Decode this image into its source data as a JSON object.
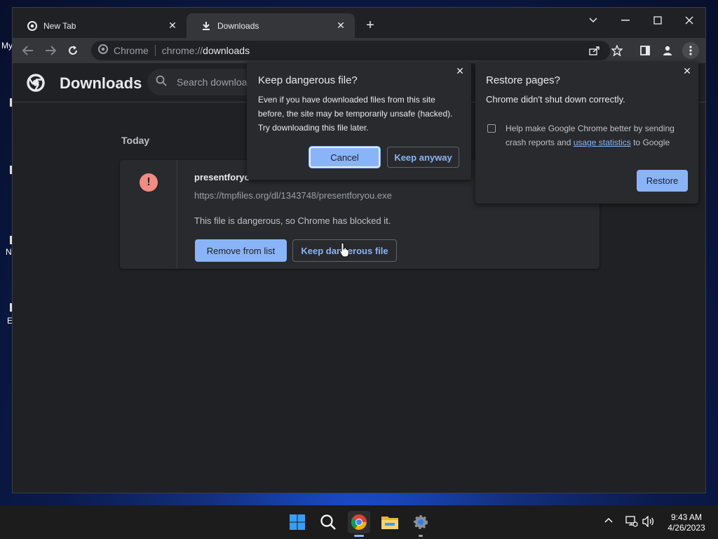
{
  "desktop": {
    "icon_labels": [
      "My",
      "N",
      "E"
    ]
  },
  "tabs": [
    {
      "title": "New Tab",
      "active": false
    },
    {
      "title": "Downloads",
      "active": true
    }
  ],
  "omnibox": {
    "site": "Chrome",
    "scheme": "chrome://",
    "path": "downloads"
  },
  "page": {
    "title": "Downloads",
    "search_placeholder": "Search downloads",
    "day_label": "Today",
    "download": {
      "filename": "presentforyou.exe",
      "url": "https://tmpfiles.org/dl/1343748/presentforyou.exe",
      "status": "This file is dangerous, so Chrome has blocked it.",
      "remove_label": "Remove from list",
      "keep_label": "Keep dangerous file"
    }
  },
  "keep_dialog": {
    "title": "Keep dangerous file?",
    "body_line1": "Even if you have downloaded files from this site",
    "body_line2": "before, the site may be temporarily unsafe (hacked).",
    "body_line3": "Try downloading this file later.",
    "cancel_label": "Cancel",
    "keep_label": "Keep anyway"
  },
  "restore_dialog": {
    "title": "Restore pages?",
    "subtitle": "Chrome didn't shut down correctly.",
    "checkbox_line1": "Help make Google Chrome better by sending",
    "checkbox_pre": "crash reports and ",
    "checkbox_link": "usage statistics",
    "checkbox_post": " to Google",
    "restore_label": "Restore"
  },
  "taskbar": {
    "time": "9:43 AM",
    "date": "4/26/2023"
  },
  "colors": {
    "accent": "#8ab4f8",
    "danger": "#f28b82",
    "window_bg": "#202124",
    "surface": "#292a2d"
  }
}
